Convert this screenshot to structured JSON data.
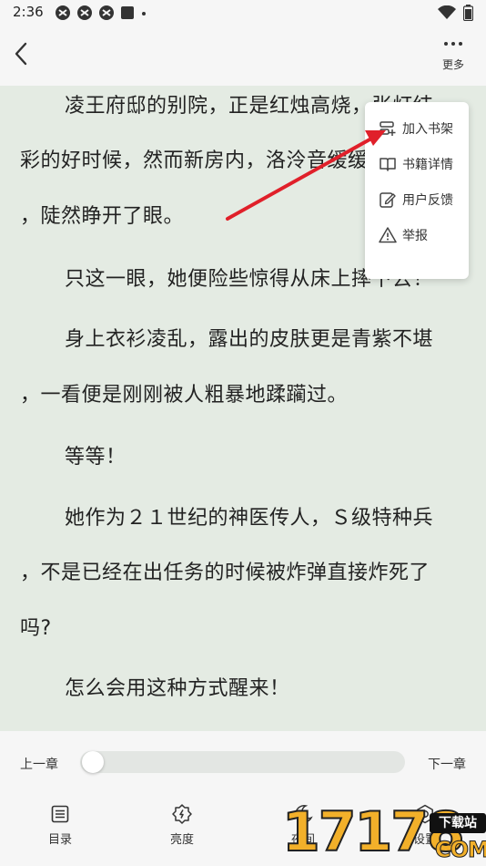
{
  "status_bar": {
    "time": "2:36"
  },
  "toolbar": {
    "more_label": "更多"
  },
  "content": {
    "lines": [
      "凌王府邸的别院，正是红烛高烧，张灯结",
      "彩的好时候，然而新房内，洛泠音缓缓",
      "，陡然睁开了眼。",
      "只这一眼，她便险些惊得从床上摔下去！",
      "身上衣衫凌乱，露出的皮肤更是青紫不堪",
      "，一看便是刚刚被人粗暴地蹂躏过。",
      "等等！",
      "她作为２１世纪的神医传人，Ｓ级特种兵",
      "，不是已经在出任务的时候被炸弹直接炸死了",
      "吗?",
      "怎么会用这种方式醒来！"
    ]
  },
  "menu": {
    "items": [
      {
        "label": "加入书架",
        "icon": "add-to-shelf-icon"
      },
      {
        "label": "书籍详情",
        "icon": "book-icon"
      },
      {
        "label": "用户反馈",
        "icon": "feedback-icon"
      },
      {
        "label": "举报",
        "icon": "warning-icon"
      }
    ]
  },
  "bottom": {
    "prev_chapter": "上一章",
    "next_chapter": "下一章",
    "progress": 0,
    "tabs": [
      {
        "label": "目录",
        "icon": "list-icon"
      },
      {
        "label": "亮度",
        "icon": "brightness-icon"
      },
      {
        "label": "夜间",
        "icon": "night-icon"
      },
      {
        "label": "设置",
        "icon": "settings-icon"
      }
    ]
  },
  "watermark": {
    "digits": "17178",
    "badge": "下载站",
    "suffix": "COM"
  },
  "colors": {
    "page_bg": "#e4ebe3",
    "bar_bg": "#f6f6f6",
    "arrow": "#e0202a",
    "watermark": "#f2b02a"
  }
}
